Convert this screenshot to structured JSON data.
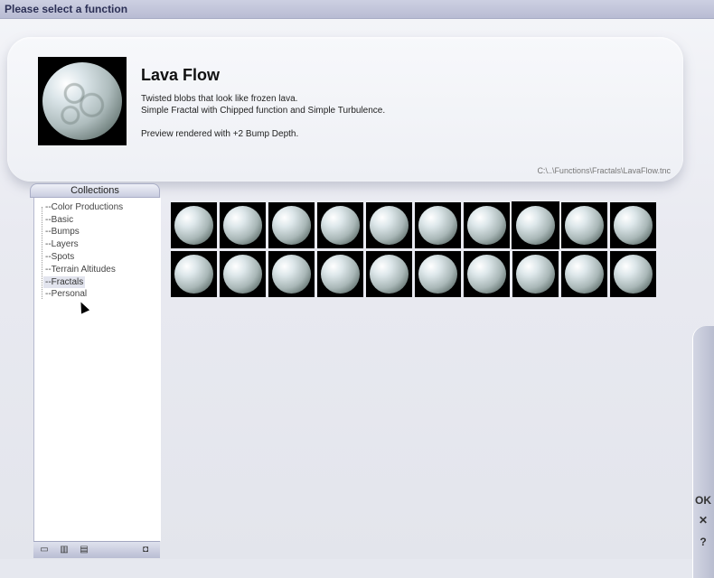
{
  "window": {
    "title": "Please select a function"
  },
  "function_info": {
    "name": "Lava Flow",
    "description_lines": [
      "Twisted blobs that look like frozen lava.",
      "Simple Fractal with Chipped function and Simple Turbulence.",
      "",
      "Preview rendered with +2 Bump Depth."
    ],
    "path": "C:\\..\\Functions\\Fractals\\LavaFlow.tnc"
  },
  "collections": {
    "header": "Collections",
    "items": [
      {
        "label": "Color Productions",
        "selected": false
      },
      {
        "label": "Basic",
        "selected": false
      },
      {
        "label": "Bumps",
        "selected": false
      },
      {
        "label": "Layers",
        "selected": false
      },
      {
        "label": "Spots",
        "selected": false
      },
      {
        "label": "Terrain Altitudes",
        "selected": false
      },
      {
        "label": "Fractals",
        "selected": true
      },
      {
        "label": "Personal",
        "selected": false
      }
    ],
    "footer_icons": [
      "new-collection-icon",
      "trash-icon",
      "open-folder-icon",
      "settings-icon"
    ]
  },
  "thumbnails": {
    "rows": 2,
    "columns": 10,
    "selected_index": 7,
    "icon": "sphere-preview-icon"
  },
  "side_buttons": [
    {
      "label": "OK",
      "name": "ok-button"
    },
    {
      "label": "✕",
      "name": "cancel-button"
    },
    {
      "label": "?",
      "name": "help-button"
    }
  ]
}
